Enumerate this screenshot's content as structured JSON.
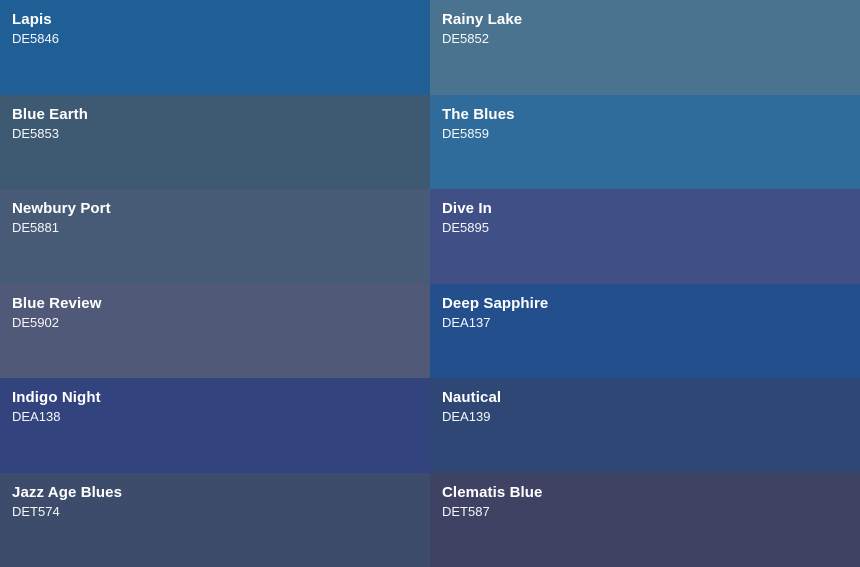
{
  "swatches": [
    {
      "name": "Lapis",
      "code": "DE5846",
      "color": "#1f5f95"
    },
    {
      "name": "Rainy Lake",
      "code": "DE5852",
      "color": "#4a7390"
    },
    {
      "name": "Blue Earth",
      "code": "DE5853",
      "color": "#3d5a72"
    },
    {
      "name": "The Blues",
      "code": "DE5859",
      "color": "#2f6c9c"
    },
    {
      "name": "Newbury Port",
      "code": "DE5881",
      "color": "#485b76"
    },
    {
      "name": "Dive In",
      "code": "DE5895",
      "color": "#404f86"
    },
    {
      "name": "Blue Review",
      "code": "DE5902",
      "color": "#505a78"
    },
    {
      "name": "Deep Sapphire",
      "code": "DEA137",
      "color": "#234f8d"
    },
    {
      "name": "Indigo Night",
      "code": "DEA138",
      "color": "#33437e"
    },
    {
      "name": "Nautical",
      "code": "DEA139",
      "color": "#2f4775"
    },
    {
      "name": "Jazz Age Blues",
      "code": "DET574",
      "color": "#3d4c6b"
    },
    {
      "name": "Clematis Blue",
      "code": "DET587",
      "color": "#3f4263"
    }
  ]
}
